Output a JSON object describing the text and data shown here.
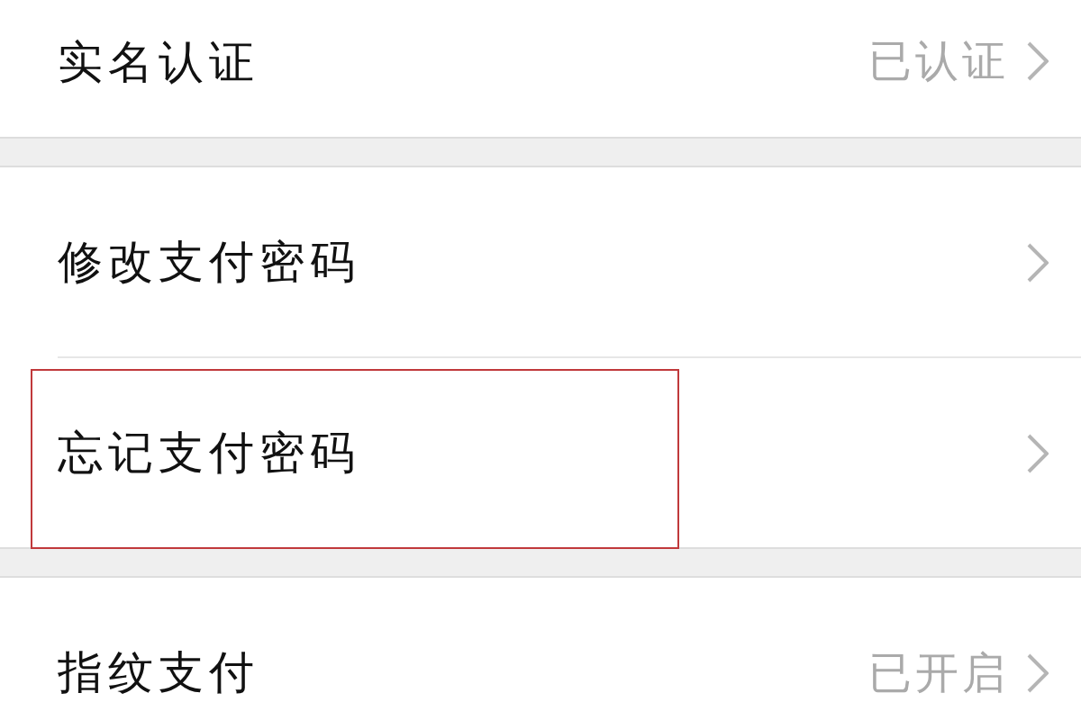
{
  "groups": [
    {
      "items": [
        {
          "label": "实名认证",
          "value": "已认证",
          "highlighted": false
        }
      ]
    },
    {
      "items": [
        {
          "label": "修改支付密码",
          "highlighted": false
        },
        {
          "label": "忘记支付密码",
          "highlighted": true
        }
      ]
    },
    {
      "items": [
        {
          "label": "指纹支付",
          "value": "已开启",
          "highlighted": false
        }
      ]
    }
  ]
}
